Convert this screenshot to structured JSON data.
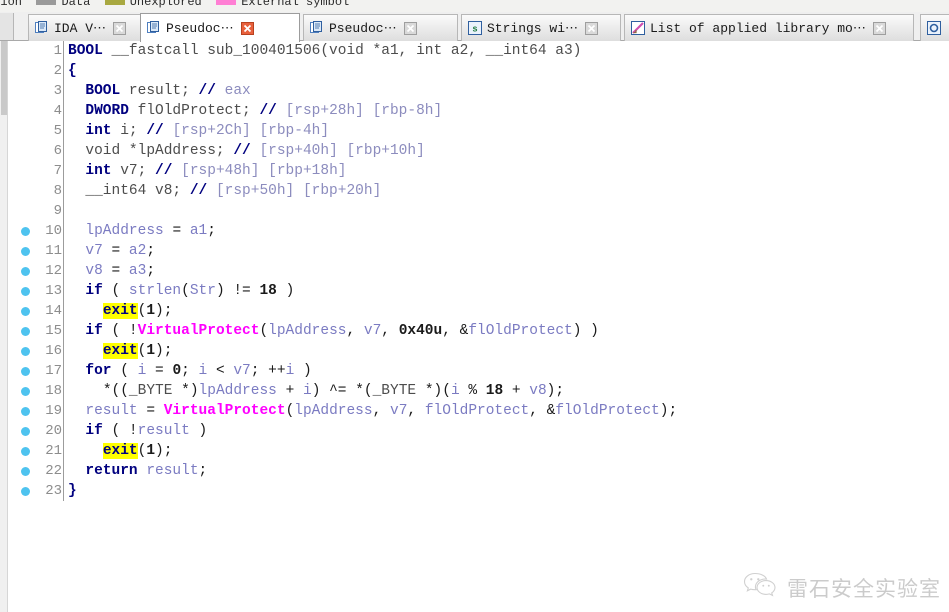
{
  "legend": {
    "items": [
      {
        "label": "ction",
        "color": "",
        "truncated_left": true
      },
      {
        "label": "Data",
        "color": "#9a9a9a"
      },
      {
        "label": "Unexplored",
        "color": "#a8a840"
      },
      {
        "label": "External symbol",
        "color": "#ff7fd4"
      }
    ]
  },
  "tabs": [
    {
      "label": "IDA V⋯",
      "icon": "pseudocode-icon",
      "active": false,
      "close": "close-icon",
      "close_style": "grey"
    },
    {
      "label": "Pseudoc⋯",
      "icon": "pseudocode-icon",
      "active": true,
      "close": "close-icon",
      "close_style": "red"
    },
    {
      "label": "Pseudoc⋯",
      "icon": "pseudocode-icon",
      "active": false,
      "close": "close-icon",
      "close_style": "grey"
    },
    {
      "label": "Strings wi⋯",
      "icon": "strings-icon",
      "active": false,
      "close": "close-icon",
      "close_style": "grey"
    },
    {
      "label": "List of applied library mo⋯",
      "icon": "library-icon",
      "active": false,
      "close": "close-icon",
      "close_style": "grey"
    },
    {
      "label": "",
      "icon": "partial-icon",
      "active": false,
      "close": "",
      "close_style": ""
    }
  ],
  "code": {
    "function_name": "sub_100401506",
    "lines": [
      {
        "n": "1",
        "bp": false,
        "html": "<span class=\"t-type\">BOOL</span> <span class=\"t-plain\">__fastcall sub_100401506(void *a1, int a2, __int64 a3)</span>"
      },
      {
        "n": "2",
        "bp": false,
        "html": "<span class=\"t-kw\">{</span>"
      },
      {
        "n": "3",
        "bp": false,
        "html": "  <span class=\"t-kw\">BOOL</span> <span class=\"t-plain\">result;</span> <span class=\"t-cmtslash\">//</span> <span class=\"t-cmt\">eax</span>"
      },
      {
        "n": "4",
        "bp": false,
        "html": "  <span class=\"t-kw\">DWORD</span> <span class=\"t-plain\">flOldProtect;</span> <span class=\"t-cmtslash\">//</span> <span class=\"t-cmt\">[rsp+28h] [rbp-8h]</span>"
      },
      {
        "n": "5",
        "bp": false,
        "html": "  <span class=\"t-kw\">int</span> <span class=\"t-plain\">i;</span> <span class=\"t-cmtslash\">//</span> <span class=\"t-cmt\">[rsp+2Ch] [rbp-4h]</span>"
      },
      {
        "n": "6",
        "bp": false,
        "html": "  <span class=\"t-plain\">void *lpAddress;</span> <span class=\"t-cmtslash\">//</span> <span class=\"t-cmt\">[rsp+40h] [rbp+10h]</span>"
      },
      {
        "n": "7",
        "bp": false,
        "html": "  <span class=\"t-kw\">int</span> <span class=\"t-plain\">v7;</span> <span class=\"t-cmtslash\">//</span> <span class=\"t-cmt\">[rsp+48h] [rbp+18h]</span>"
      },
      {
        "n": "8",
        "bp": false,
        "html": "  <span class=\"t-plain\">__int64 v8;</span> <span class=\"t-cmtslash\">//</span> <span class=\"t-cmt\">[rsp+50h] [rbp+20h]</span>"
      },
      {
        "n": "9",
        "bp": false,
        "html": ""
      },
      {
        "n": "10",
        "bp": true,
        "html": "  <span class=\"t-var\">lpAddress</span> <span class=\"t-op\">=</span> <span class=\"t-var\">a1</span><span class=\"t-punct\">;</span>"
      },
      {
        "n": "11",
        "bp": true,
        "html": "  <span class=\"t-var\">v7</span> <span class=\"t-op\">=</span> <span class=\"t-var\">a2</span><span class=\"t-punct\">;</span>"
      },
      {
        "n": "12",
        "bp": true,
        "html": "  <span class=\"t-var\">v8</span> <span class=\"t-op\">=</span> <span class=\"t-var\">a3</span><span class=\"t-punct\">;</span>"
      },
      {
        "n": "13",
        "bp": true,
        "html": "  <span class=\"t-kw\">if</span> <span class=\"t-punct\">(</span> <span class=\"t-var\">strlen</span><span class=\"t-punct\">(</span><span class=\"t-var\">Str</span><span class=\"t-punct\">)</span> <span class=\"t-op\">!=</span> <span class=\"t-num\">18</span> <span class=\"t-punct\">)</span>"
      },
      {
        "n": "14",
        "bp": true,
        "html": "    <span class=\"t-hl\">exit</span><span class=\"t-punct\">(</span><span class=\"t-num\">1</span><span class=\"t-punct\">);</span>"
      },
      {
        "n": "15",
        "bp": true,
        "html": "  <span class=\"t-kw\">if</span> <span class=\"t-punct\">(</span> <span class=\"t-op\">!</span><span class=\"t-fn\">VirtualProtect</span><span class=\"t-punct\">(</span><span class=\"t-var\">lpAddress</span><span class=\"t-punct\">,</span> <span class=\"t-var\">v7</span><span class=\"t-punct\">,</span> <span class=\"t-num\">0x40u</span><span class=\"t-punct\">,</span> <span class=\"t-op\">&amp;</span><span class=\"t-var\">flOldProtect</span><span class=\"t-punct\">)</span> <span class=\"t-punct\">)</span>"
      },
      {
        "n": "16",
        "bp": true,
        "html": "    <span class=\"t-hl\">exit</span><span class=\"t-punct\">(</span><span class=\"t-num\">1</span><span class=\"t-punct\">);</span>"
      },
      {
        "n": "17",
        "bp": true,
        "html": "  <span class=\"t-kw\">for</span> <span class=\"t-punct\">(</span> <span class=\"t-var\">i</span> <span class=\"t-op\">=</span> <span class=\"t-num\">0</span><span class=\"t-punct\">;</span> <span class=\"t-var\">i</span> <span class=\"t-op\">&lt;</span> <span class=\"t-var\">v7</span><span class=\"t-punct\">;</span> <span class=\"t-op\">++</span><span class=\"t-var\">i</span> <span class=\"t-punct\">)</span>"
      },
      {
        "n": "18",
        "bp": true,
        "html": "    <span class=\"t-op\">*</span><span class=\"t-punct\">((</span><span class=\"t-sym\">_BYTE</span> <span class=\"t-op\">*</span><span class=\"t-punct\">)</span><span class=\"t-var\">lpAddress</span> <span class=\"t-op\">+</span> <span class=\"t-var\">i</span><span class=\"t-punct\">)</span> <span class=\"t-op\">^=</span> <span class=\"t-op\">*</span><span class=\"t-punct\">(</span><span class=\"t-sym\">_BYTE</span> <span class=\"t-op\">*</span><span class=\"t-punct\">)(</span><span class=\"t-var\">i</span> <span class=\"t-op\">%</span> <span class=\"t-num\">18</span> <span class=\"t-op\">+</span> <span class=\"t-var\">v8</span><span class=\"t-punct\">);</span>"
      },
      {
        "n": "19",
        "bp": true,
        "html": "  <span class=\"t-var\">result</span> <span class=\"t-op\">=</span> <span class=\"t-fn\">VirtualProtect</span><span class=\"t-punct\">(</span><span class=\"t-var\">lpAddress</span><span class=\"t-punct\">,</span> <span class=\"t-var\">v7</span><span class=\"t-punct\">,</span> <span class=\"t-var\">flOldProtect</span><span class=\"t-punct\">,</span> <span class=\"t-op\">&amp;</span><span class=\"t-var\">flOldProtect</span><span class=\"t-punct\">);</span>"
      },
      {
        "n": "20",
        "bp": true,
        "html": "  <span class=\"t-kw\">if</span> <span class=\"t-punct\">(</span> <span class=\"t-op\">!</span><span class=\"t-var\">result</span> <span class=\"t-punct\">)</span>"
      },
      {
        "n": "21",
        "bp": true,
        "html": "    <span class=\"t-hl\">exit</span><span class=\"t-punct\">(</span><span class=\"t-num\">1</span><span class=\"t-punct\">);</span>"
      },
      {
        "n": "22",
        "bp": true,
        "html": "  <span class=\"t-kw\">return</span> <span class=\"t-var\">result</span><span class=\"t-punct\">;</span>"
      },
      {
        "n": "23",
        "bp": true,
        "html": "<span class=\"t-kw\">}</span>"
      }
    ],
    "plain_lines": [
      "BOOL __fastcall sub_100401506(void *a1, int a2, __int64 a3)",
      "{",
      "  BOOL result; // eax",
      "  DWORD flOldProtect; // [rsp+28h] [rbp-8h]",
      "  int i; // [rsp+2Ch] [rbp-4h]",
      "  void *lpAddress; // [rsp+40h] [rbp+10h]",
      "  int v7; // [rsp+48h] [rbp+18h]",
      "  __int64 v8; // [rsp+50h] [rbp+20h]",
      "",
      "  lpAddress = a1;",
      "  v7 = a2;",
      "  v8 = a3;",
      "  if ( strlen(Str) != 18 )",
      "    exit(1);",
      "  if ( !VirtualProtect(lpAddress, v7, 0x40u, &flOldProtect) )",
      "    exit(1);",
      "  for ( i = 0; i < v7; ++i )",
      "    *((_BYTE *)lpAddress + i) ^= *(_BYTE *)(i % 18 + v8);",
      "  result = VirtualProtect(lpAddress, v7, flOldProtect, &flOldProtect);",
      "  if ( !result )",
      "    exit(1);",
      "  return result;",
      "}"
    ]
  },
  "watermark": {
    "icon": "wechat-icon",
    "text": "雷石安全实验室"
  },
  "colors": {
    "highlight": "#ffff00",
    "api": "#ff00ff",
    "keyword": "#00007f",
    "comment": "#8c8cbe",
    "breakpoint_dot": "#4ec3ef",
    "legend_data": "#9a9a9a",
    "legend_unexplored": "#a8a840",
    "legend_external": "#ff7fd4"
  }
}
